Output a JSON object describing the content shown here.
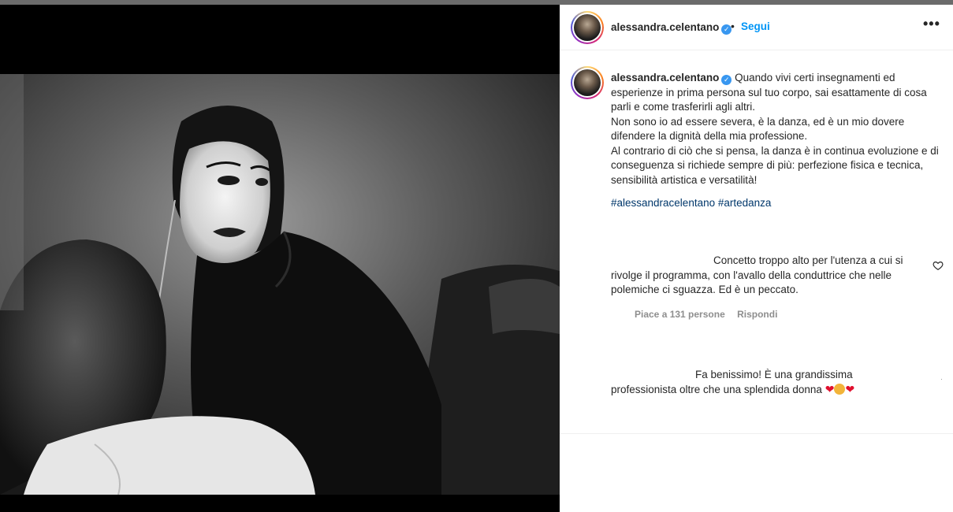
{
  "post": {
    "username": "alessandra.celentano",
    "follow_label": "Segui",
    "separator": "•",
    "more_label": "•••",
    "verified_glyph": "✓",
    "caption": {
      "username": "alessandra.celentano",
      "lines": [
        "Quando vivi certi insegnamenti ed esperienze in prima persona sul tuo corpo, sai esattamente di cosa parli e come trasferirli agli altri.",
        "Non sono io ad essere severa, è la danza, ed è un mio dovere difendere la dignità della mia professione.",
        "Al contrario di ciò che si pensa, la danza è in continua evoluzione e di conseguenza si richiede sempre di più: perfezione fisica e tecnica, sensibilità artistica e versatilità!"
      ],
      "hashtags": [
        "#alessandracelentano",
        "#artedanza"
      ]
    },
    "comments": [
      {
        "text_line1": "Concetto troppo alto per l'utenza a cui si",
        "text_rest": "rivolge il programma, con l'avallo della conduttrice che nelle polemiche ci sguazza. Ed è un peccato.",
        "likes_label": "Piace a 131 persone",
        "reply_label": "Rispondi",
        "like_icon": "heart-outline-icon"
      },
      {
        "text_line1": "Fa benissimo! È una grandissima",
        "text_rest": "professionista oltre che una splendida donna",
        "emojis": [
          "red-heart",
          "clapping-hands",
          "red-heart"
        ],
        "emoji_heart": "❤",
        "tick": "·"
      }
    ]
  },
  "colors": {
    "link_blue": "#0095f6",
    "hashtag_blue": "#00376b",
    "text": "#262626",
    "muted": "#8e8e8e",
    "verified": "#3897f0"
  }
}
